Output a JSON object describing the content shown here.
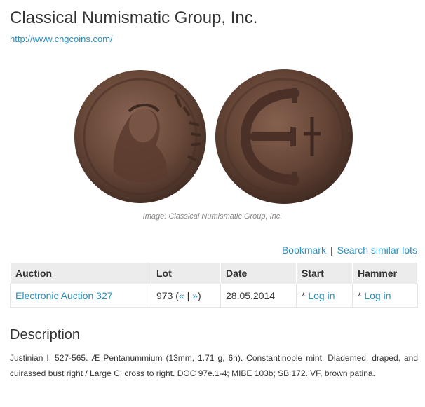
{
  "header": {
    "title": "Classical Numismatic Group, Inc.",
    "url_text": "http://www.cngcoins.com/"
  },
  "image": {
    "caption": "Image: Classical Numismatic Group, Inc."
  },
  "actions": {
    "bookmark": "Bookmark",
    "separator": "|",
    "search_similar": "Search similar lots"
  },
  "lots_table": {
    "headers": [
      "Auction",
      "Lot",
      "Date",
      "Start",
      "Hammer"
    ],
    "row": {
      "auction": "Electronic Auction 327",
      "lot_number": "973",
      "lot_open": " (",
      "prev": "«",
      "lot_sep": " | ",
      "next": "»",
      "lot_close": ")",
      "date": "28.05.2014",
      "start_prefix": "* ",
      "start_link": "Log in",
      "hammer_prefix": "* ",
      "hammer_link": "Log in"
    }
  },
  "description": {
    "heading": "Description",
    "text": "Justinian I. 527-565. Æ Pentanummium (13mm, 1.71 g, 6h). Constantinople mint. Diademed, draped, and cuirassed bust right / Large Є; cross to right. DOC 97e.1-4; MIBE 103b; SB 172. VF, brown patina."
  },
  "colors": {
    "link": "#2a8fbd",
    "text": "#333333",
    "table_header_bg": "#ececec",
    "coin_bronze": "#6b4a3a"
  }
}
